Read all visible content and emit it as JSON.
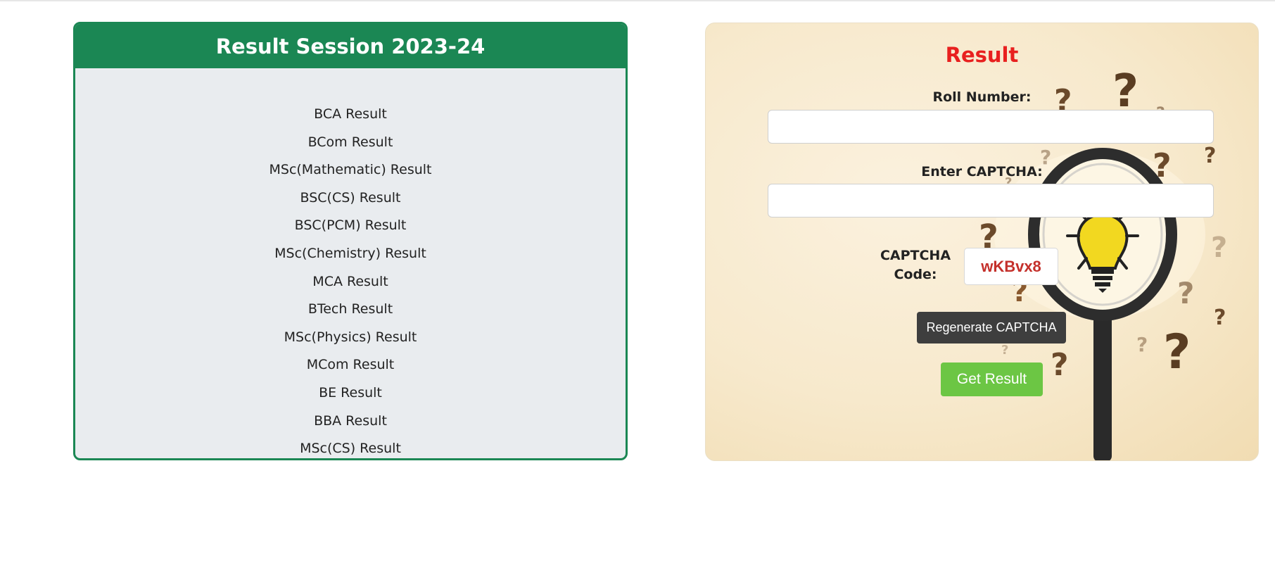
{
  "session": {
    "title": "Result Session 2023-24",
    "items": [
      "BCA Result",
      "BCom Result",
      "MSc(Mathematic) Result",
      "BSC(CS) Result",
      "BSC(PCM) Result",
      "MSc(Chemistry) Result",
      "MCA Result",
      "BTech Result",
      "MSc(Physics) Result",
      "MCom Result",
      "BE Result",
      "BBA Result",
      "MSc(CS) Result"
    ]
  },
  "form": {
    "title": "Result",
    "roll_label": "Roll Number:",
    "roll_value": "",
    "captcha_label": "Enter CAPTCHA:",
    "captcha_value": "",
    "captcha_code_label_line1": "CAPTCHA",
    "captcha_code_label_line2": "Code:",
    "captcha_code": "wKBvx8",
    "regenerate_label": "Regenerate CAPTCHA",
    "submit_label": "Get Result"
  },
  "colors": {
    "header_green": "#1b8754",
    "title_red": "#e8201f",
    "captcha_red": "#c4302b",
    "submit_green": "#6cc644",
    "regen_dark": "#3e3e3e"
  },
  "icons": [
    "magnifying-glass-icon",
    "lightbulb-icon",
    "question-mark-icon"
  ]
}
